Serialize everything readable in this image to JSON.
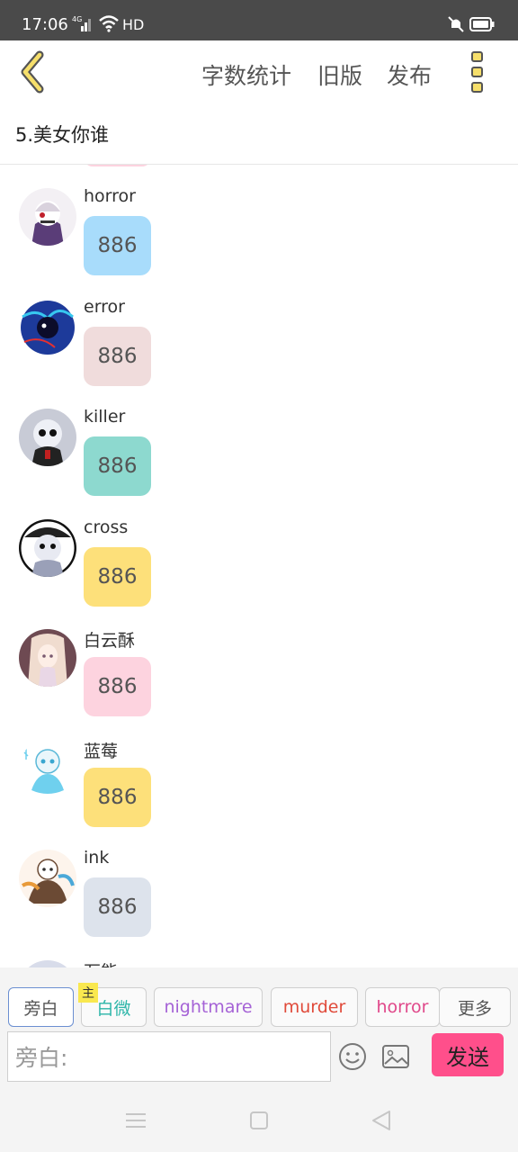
{
  "status_bar": {
    "time": "17:06",
    "network": "4G",
    "hd": "HD"
  },
  "header": {
    "links": [
      "字数统计",
      "旧版",
      "发布"
    ]
  },
  "chapter_title": "5.美女你谁",
  "messages": [
    {
      "name": "horror",
      "text": "886",
      "bubble_color": "#a8dcfb"
    },
    {
      "name": "error",
      "text": "886",
      "bubble_color": "#f0dcdc"
    },
    {
      "name": "killer",
      "text": "886",
      "bubble_color": "#8dd9cf"
    },
    {
      "name": "cross",
      "text": "886",
      "bubble_color": "#fde07a"
    },
    {
      "name": "白云酥",
      "text": "886",
      "bubble_color": "#fdd3df"
    },
    {
      "name": "蓝莓",
      "text": "886",
      "bubble_color": "#fde07a"
    },
    {
      "name": "ink",
      "text": "886",
      "bubble_color": "#dde3ec"
    },
    {
      "name": "万能",
      "text": "",
      "bubble_color": "#ffffff"
    }
  ],
  "role_chips": [
    {
      "label": "旁白",
      "color": "#555555",
      "active": true
    },
    {
      "label": "白微",
      "color": "#2bb5a8",
      "badge": "主"
    },
    {
      "label": "nightmare",
      "color": "#a562d6"
    },
    {
      "label": "murder",
      "color": "#e04a3a"
    },
    {
      "label": "horror",
      "color": "#e0488a"
    },
    {
      "label": "更多",
      "color": "#555555"
    }
  ],
  "input": {
    "placeholder": "旁白:"
  },
  "send_label": "发送"
}
